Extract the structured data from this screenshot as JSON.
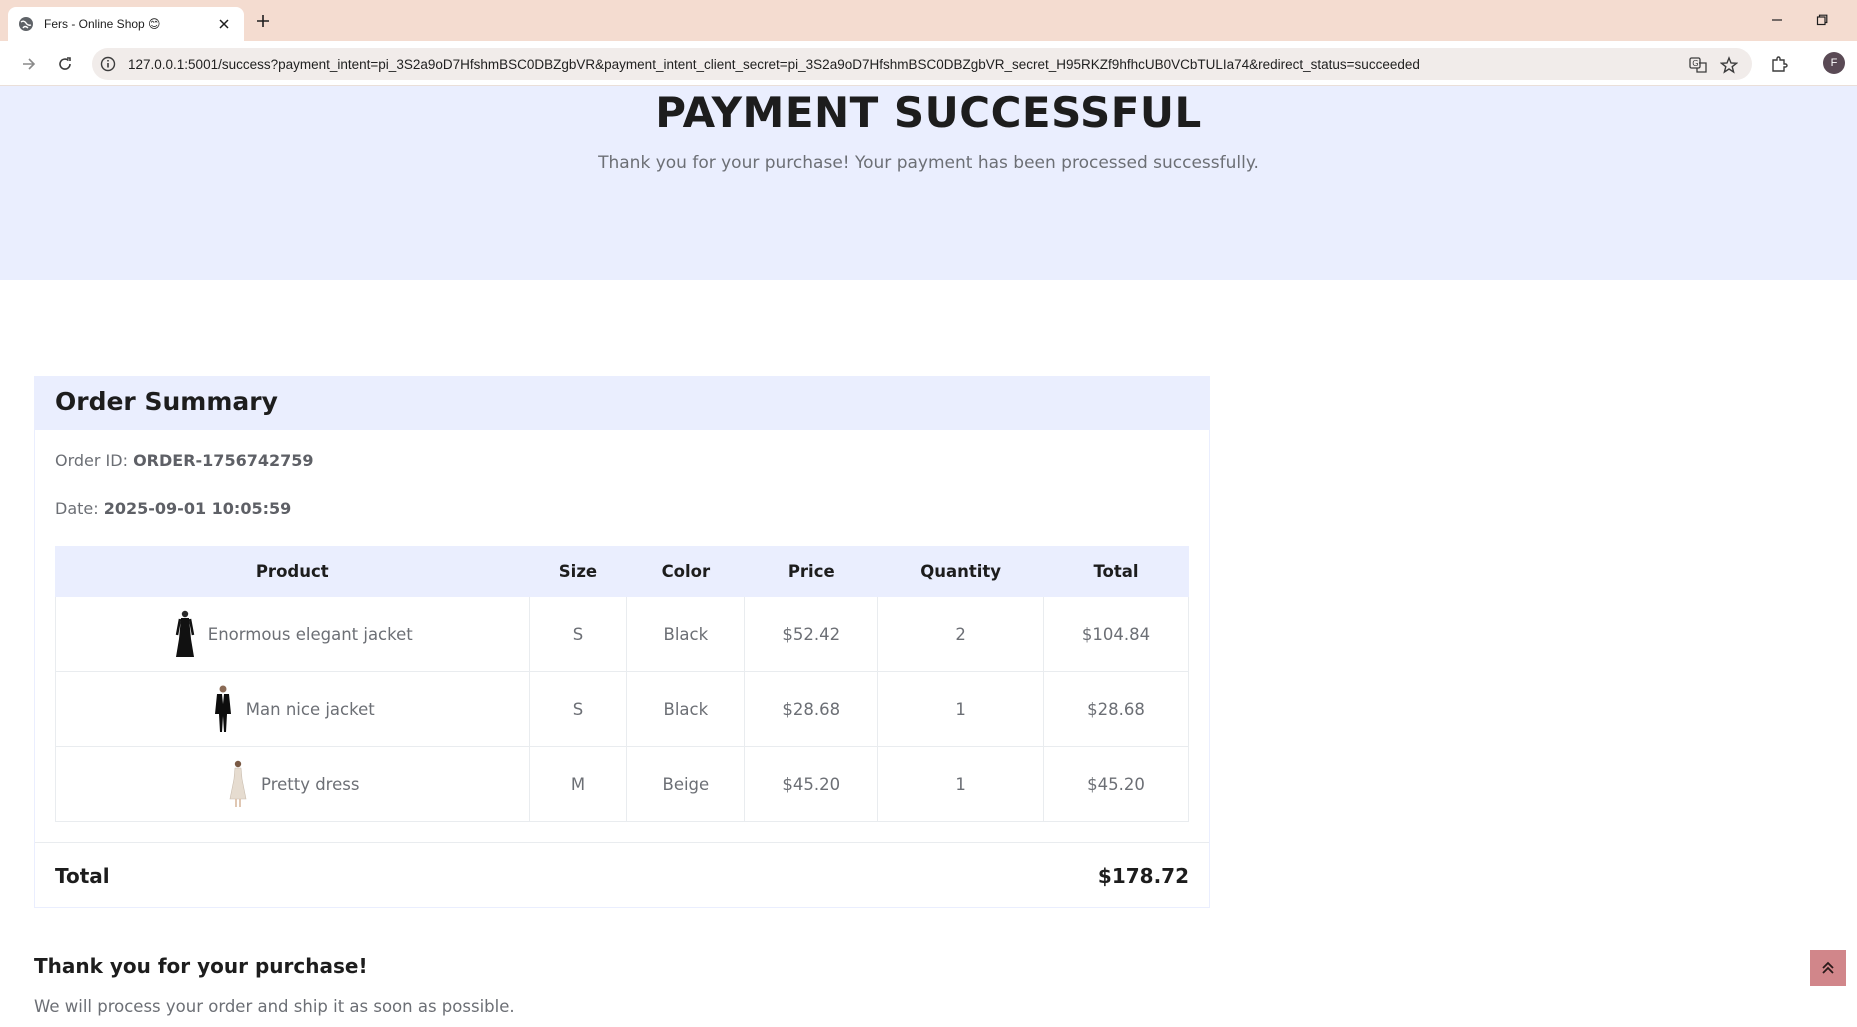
{
  "browser": {
    "tab_title": "Fers - Online Shop 😊",
    "url": "127.0.0.1:5001/success?payment_intent=pi_3S2a9oD7HfshmBSC0DBZgbVR&payment_intent_client_secret=pi_3S2a9oD7HfshmBSC0DBZgbVR_secret_H95RKZf9hfhcUB0VCbTULIa74&redirect_status=succeeded",
    "profile_initial": "F"
  },
  "hero": {
    "title": "PAYMENT SUCCESSFUL",
    "subtitle": "Thank you for your purchase! Your payment has been processed successfully."
  },
  "order": {
    "heading": "Order Summary",
    "id_label": "Order ID:",
    "id_value": "ORDER-1756742759",
    "date_label": "Date:",
    "date_value": "2025-09-01 10:05:59",
    "columns": [
      "Product",
      "Size",
      "Color",
      "Price",
      "Quantity",
      "Total"
    ],
    "items": [
      {
        "product": "Enormous elegant jacket",
        "size": "S",
        "color": "Black",
        "price": "$52.42",
        "quantity": "2",
        "total": "$104.84"
      },
      {
        "product": "Man nice jacket",
        "size": "S",
        "color": "Black",
        "price": "$28.68",
        "quantity": "1",
        "total": "$28.68"
      },
      {
        "product": "Pretty dress",
        "size": "M",
        "color": "Beige",
        "price": "$45.20",
        "quantity": "1",
        "total": "$45.20"
      }
    ],
    "total_label": "Total",
    "total_value": "$178.72"
  },
  "footer": {
    "thanks": "Thank you for your purchase!",
    "shipping": "We will process your order and ship it as soon as possible."
  },
  "colors": {
    "tabbar": "#f4dcd0",
    "hero_bg": "#eaeefe",
    "back_to_top": "#d1868a"
  }
}
